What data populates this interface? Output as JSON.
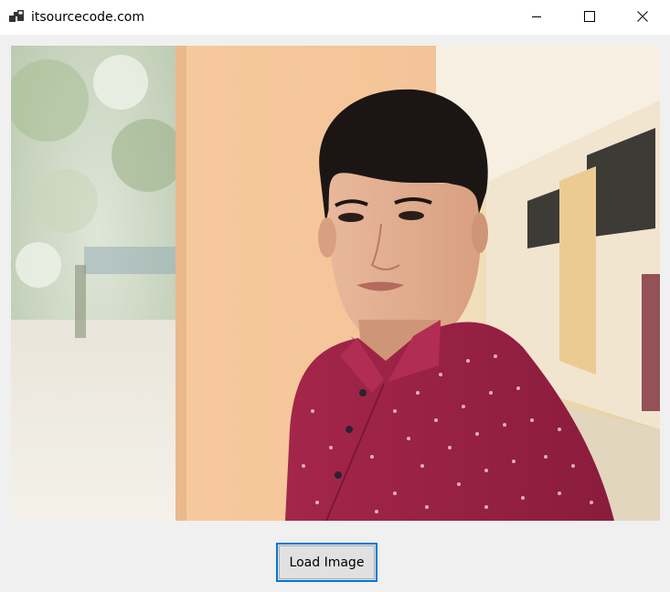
{
  "window": {
    "title": "itsourcecode.com",
    "controls": {
      "minimize_icon": "minimize-icon",
      "maximize_icon": "maximize-icon",
      "close_icon": "close-icon"
    }
  },
  "picture": {
    "subject": "portrait-photo"
  },
  "actions": {
    "load_label": "Load Image"
  },
  "colors": {
    "button_focus_border": "#0078d7",
    "button_face": "#e1e1e1",
    "window_bg": "#f0f0f0",
    "titlebar_bg": "#ffffff"
  }
}
